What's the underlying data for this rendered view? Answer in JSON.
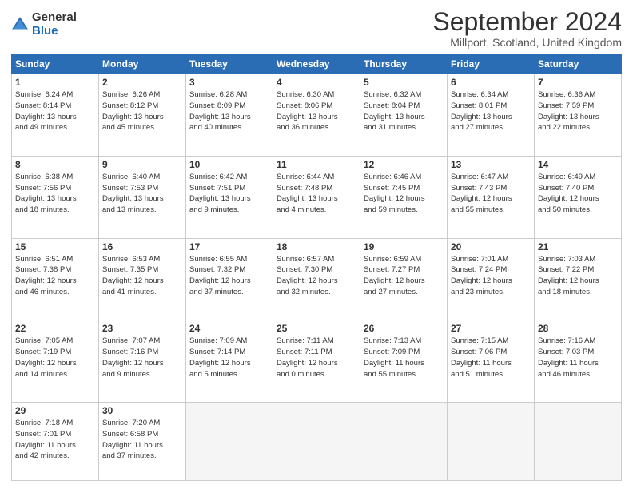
{
  "logo": {
    "general": "General",
    "blue": "Blue"
  },
  "title": "September 2024",
  "subtitle": "Millport, Scotland, United Kingdom",
  "headers": [
    "Sunday",
    "Monday",
    "Tuesday",
    "Wednesday",
    "Thursday",
    "Friday",
    "Saturday"
  ],
  "weeks": [
    [
      {
        "day": "1",
        "info": "Sunrise: 6:24 AM\nSunset: 8:14 PM\nDaylight: 13 hours\nand 49 minutes."
      },
      {
        "day": "2",
        "info": "Sunrise: 6:26 AM\nSunset: 8:12 PM\nDaylight: 13 hours\nand 45 minutes."
      },
      {
        "day": "3",
        "info": "Sunrise: 6:28 AM\nSunset: 8:09 PM\nDaylight: 13 hours\nand 40 minutes."
      },
      {
        "day": "4",
        "info": "Sunrise: 6:30 AM\nSunset: 8:06 PM\nDaylight: 13 hours\nand 36 minutes."
      },
      {
        "day": "5",
        "info": "Sunrise: 6:32 AM\nSunset: 8:04 PM\nDaylight: 13 hours\nand 31 minutes."
      },
      {
        "day": "6",
        "info": "Sunrise: 6:34 AM\nSunset: 8:01 PM\nDaylight: 13 hours\nand 27 minutes."
      },
      {
        "day": "7",
        "info": "Sunrise: 6:36 AM\nSunset: 7:59 PM\nDaylight: 13 hours\nand 22 minutes."
      }
    ],
    [
      {
        "day": "8",
        "info": "Sunrise: 6:38 AM\nSunset: 7:56 PM\nDaylight: 13 hours\nand 18 minutes."
      },
      {
        "day": "9",
        "info": "Sunrise: 6:40 AM\nSunset: 7:53 PM\nDaylight: 13 hours\nand 13 minutes."
      },
      {
        "day": "10",
        "info": "Sunrise: 6:42 AM\nSunset: 7:51 PM\nDaylight: 13 hours\nand 9 minutes."
      },
      {
        "day": "11",
        "info": "Sunrise: 6:44 AM\nSunset: 7:48 PM\nDaylight: 13 hours\nand 4 minutes."
      },
      {
        "day": "12",
        "info": "Sunrise: 6:46 AM\nSunset: 7:45 PM\nDaylight: 12 hours\nand 59 minutes."
      },
      {
        "day": "13",
        "info": "Sunrise: 6:47 AM\nSunset: 7:43 PM\nDaylight: 12 hours\nand 55 minutes."
      },
      {
        "day": "14",
        "info": "Sunrise: 6:49 AM\nSunset: 7:40 PM\nDaylight: 12 hours\nand 50 minutes."
      }
    ],
    [
      {
        "day": "15",
        "info": "Sunrise: 6:51 AM\nSunset: 7:38 PM\nDaylight: 12 hours\nand 46 minutes."
      },
      {
        "day": "16",
        "info": "Sunrise: 6:53 AM\nSunset: 7:35 PM\nDaylight: 12 hours\nand 41 minutes."
      },
      {
        "day": "17",
        "info": "Sunrise: 6:55 AM\nSunset: 7:32 PM\nDaylight: 12 hours\nand 37 minutes."
      },
      {
        "day": "18",
        "info": "Sunrise: 6:57 AM\nSunset: 7:30 PM\nDaylight: 12 hours\nand 32 minutes."
      },
      {
        "day": "19",
        "info": "Sunrise: 6:59 AM\nSunset: 7:27 PM\nDaylight: 12 hours\nand 27 minutes."
      },
      {
        "day": "20",
        "info": "Sunrise: 7:01 AM\nSunset: 7:24 PM\nDaylight: 12 hours\nand 23 minutes."
      },
      {
        "day": "21",
        "info": "Sunrise: 7:03 AM\nSunset: 7:22 PM\nDaylight: 12 hours\nand 18 minutes."
      }
    ],
    [
      {
        "day": "22",
        "info": "Sunrise: 7:05 AM\nSunset: 7:19 PM\nDaylight: 12 hours\nand 14 minutes."
      },
      {
        "day": "23",
        "info": "Sunrise: 7:07 AM\nSunset: 7:16 PM\nDaylight: 12 hours\nand 9 minutes."
      },
      {
        "day": "24",
        "info": "Sunrise: 7:09 AM\nSunset: 7:14 PM\nDaylight: 12 hours\nand 5 minutes."
      },
      {
        "day": "25",
        "info": "Sunrise: 7:11 AM\nSunset: 7:11 PM\nDaylight: 12 hours\nand 0 minutes."
      },
      {
        "day": "26",
        "info": "Sunrise: 7:13 AM\nSunset: 7:09 PM\nDaylight: 11 hours\nand 55 minutes."
      },
      {
        "day": "27",
        "info": "Sunrise: 7:15 AM\nSunset: 7:06 PM\nDaylight: 11 hours\nand 51 minutes."
      },
      {
        "day": "28",
        "info": "Sunrise: 7:16 AM\nSunset: 7:03 PM\nDaylight: 11 hours\nand 46 minutes."
      }
    ],
    [
      {
        "day": "29",
        "info": "Sunrise: 7:18 AM\nSunset: 7:01 PM\nDaylight: 11 hours\nand 42 minutes."
      },
      {
        "day": "30",
        "info": "Sunrise: 7:20 AM\nSunset: 6:58 PM\nDaylight: 11 hours\nand 37 minutes."
      },
      {
        "day": "",
        "info": ""
      },
      {
        "day": "",
        "info": ""
      },
      {
        "day": "",
        "info": ""
      },
      {
        "day": "",
        "info": ""
      },
      {
        "day": "",
        "info": ""
      }
    ]
  ]
}
